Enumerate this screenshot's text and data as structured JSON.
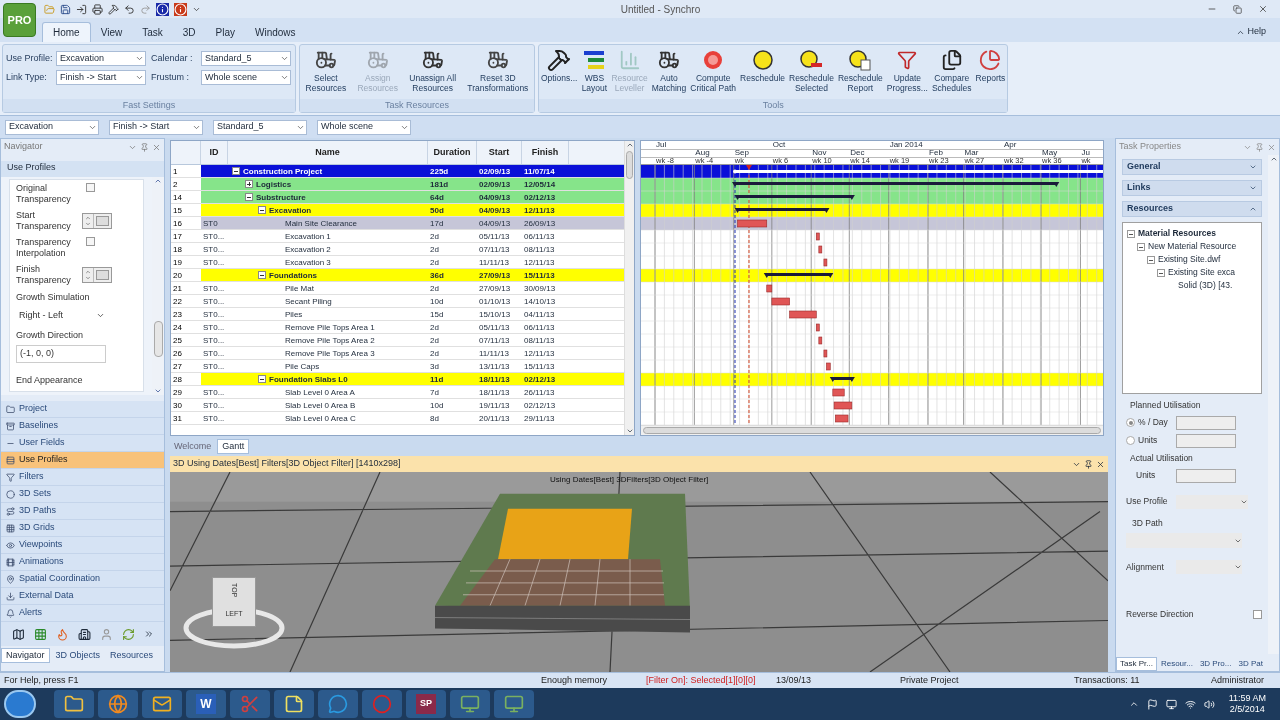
{
  "window": {
    "title": "Untitled - Synchro",
    "app_button": "PRO"
  },
  "ribbon_tabs": [
    {
      "label": "Home",
      "selected": true
    },
    {
      "label": "View",
      "selected": false
    },
    {
      "label": "Task",
      "selected": false
    },
    {
      "label": "3D",
      "selected": false
    },
    {
      "label": "Play",
      "selected": false
    },
    {
      "label": "Windows",
      "selected": false
    }
  ],
  "help": "Help",
  "fast_settings": {
    "label": "Fast Settings",
    "fields": [
      {
        "label": "Use Profile:",
        "value": "Excavation"
      },
      {
        "label": "Calendar :",
        "value": "Standard_5"
      },
      {
        "label": "Link Type:",
        "value": "Finish -> Start"
      },
      {
        "label": "Frustum :",
        "value": "Whole scene"
      }
    ]
  },
  "task_resources": {
    "label": "Task Resources",
    "buttons": [
      {
        "lines": [
          "Select",
          "Resources"
        ],
        "disabled": false
      },
      {
        "lines": [
          "Assign",
          "Resources"
        ],
        "disabled": true
      },
      {
        "lines": [
          "Unassign All",
          "Resources"
        ],
        "disabled": false
      },
      {
        "lines": [
          "Reset 3D",
          "Transformations"
        ],
        "disabled": false
      }
    ]
  },
  "tools": {
    "label": "Tools",
    "buttons": [
      {
        "lines": [
          "Options..."
        ],
        "disabled": false
      },
      {
        "lines": [
          "WBS",
          "Layout"
        ],
        "disabled": false
      },
      {
        "lines": [
          "Resource",
          "Leveller"
        ],
        "disabled": true
      },
      {
        "lines": [
          "Auto",
          "Matching"
        ],
        "disabled": false
      },
      {
        "lines": [
          "Compute",
          "Critical Path"
        ],
        "disabled": false
      },
      {
        "lines": [
          "Reschedule"
        ],
        "disabled": false
      },
      {
        "lines": [
          "Reschedule",
          "Selected"
        ],
        "disabled": false
      },
      {
        "lines": [
          "Reschedule",
          "Report"
        ],
        "disabled": false
      },
      {
        "lines": [
          "Update",
          "Progress..."
        ],
        "disabled": false
      },
      {
        "lines": [
          "Compare",
          "Schedules"
        ],
        "disabled": false
      },
      {
        "lines": [
          "Reports"
        ],
        "disabled": false
      }
    ]
  },
  "toolbar": [
    "Excavation",
    "Finish -> Start",
    "Standard_5",
    "Whole scene"
  ],
  "navigator": {
    "title": "Navigator",
    "section": "Use Profiles",
    "form": [
      {
        "kind": "checkbox",
        "label": "Original Transparency",
        "checked": false
      },
      {
        "kind": "spinner",
        "label": "Start Transparency"
      },
      {
        "kind": "checkbox",
        "label": "Transparency Interpolation",
        "checked": false
      },
      {
        "kind": "spinner",
        "label": "Finish Transparency"
      },
      {
        "kind": "dropdown",
        "label": "Growth Simulation",
        "value": "Right - Left"
      },
      {
        "kind": "field",
        "label": "Growth Direction",
        "value": "(-1, 0, 0)"
      },
      {
        "kind": "heading",
        "label": "End Appearance"
      }
    ],
    "items": [
      {
        "label": "Project",
        "selected": false
      },
      {
        "label": "Baselines",
        "selected": false
      },
      {
        "label": "User Fields",
        "selected": false
      },
      {
        "label": "Use Profiles",
        "selected": true
      },
      {
        "label": "Filters",
        "selected": false
      },
      {
        "label": "3D Sets",
        "selected": false
      },
      {
        "label": "3D Paths",
        "selected": false
      },
      {
        "label": "3D Grids",
        "selected": false
      },
      {
        "label": "Viewpoints",
        "selected": false
      },
      {
        "label": "Animations",
        "selected": false
      },
      {
        "label": "Spatial Coordination",
        "selected": false
      },
      {
        "label": "External Data",
        "selected": false
      },
      {
        "label": "Alerts",
        "selected": false
      }
    ],
    "tabs": [
      {
        "label": "Navigator",
        "selected": true
      },
      {
        "label": "3D Objects",
        "selected": false
      },
      {
        "label": "Resources",
        "selected": false
      }
    ]
  },
  "table": {
    "columns": [
      "ID",
      "Name",
      "Duration",
      "Start",
      "Finish"
    ]
  },
  "tasks": [
    {
      "num": "1",
      "name": "Construction Project",
      "duration": "225d",
      "start": "02/09/13",
      "finish": "11/07/14",
      "expanded": true,
      "children": [
        {
          "num": "2",
          "name": "Logistics",
          "duration": "181d",
          "start": "02/09/13",
          "finish": "12/05/14",
          "expanded": false
        },
        {
          "num": "14",
          "name": "Substructure",
          "duration": "64d",
          "start": "04/09/13",
          "finish": "02/12/13",
          "expanded": true,
          "children": [
            {
              "num": "15",
              "name": "Excavation",
              "duration": "50d",
              "start": "04/09/13",
              "finish": "12/11/13",
              "expanded": true,
              "children": [
                {
                  "num": "16",
                  "id": "ST0",
                  "name": "Main Site Clearance",
                  "duration": "17d",
                  "start": "04/09/13",
                  "finish": "26/09/13",
                  "selected": true
                },
                {
                  "num": "17",
                  "id": "ST0...",
                  "name": "Excavation 1",
                  "duration": "2d",
                  "start": "05/11/13",
                  "finish": "06/11/13",
                  "selected": false
                },
                {
                  "num": "18",
                  "id": "ST0...",
                  "name": "Excavation 2",
                  "duration": "2d",
                  "start": "07/11/13",
                  "finish": "08/11/13",
                  "selected": false
                },
                {
                  "num": "19",
                  "id": "ST0...",
                  "name": "Excavation 3",
                  "duration": "2d",
                  "start": "11/11/13",
                  "finish": "12/11/13",
                  "selected": false
                }
              ]
            },
            {
              "num": "20",
              "name": "Foundations",
              "duration": "36d",
              "start": "27/09/13",
              "finish": "15/11/13",
              "expanded": true,
              "children": [
                {
                  "num": "21",
                  "id": "ST0...",
                  "name": "Pile Mat",
                  "duration": "2d",
                  "start": "27/09/13",
                  "finish": "30/09/13",
                  "selected": false
                },
                {
                  "num": "22",
                  "id": "ST0...",
                  "name": "Secant Piling",
                  "duration": "10d",
                  "start": "01/10/13",
                  "finish": "14/10/13",
                  "selected": false
                },
                {
                  "num": "23",
                  "id": "ST0...",
                  "name": "Piles",
                  "duration": "15d",
                  "start": "15/10/13",
                  "finish": "04/11/13",
                  "selected": false
                },
                {
                  "num": "24",
                  "id": "ST0...",
                  "name": "Remove Pile Tops Area 1",
                  "duration": "2d",
                  "start": "05/11/13",
                  "finish": "06/11/13",
                  "selected": false
                },
                {
                  "num": "25",
                  "id": "ST0...",
                  "name": "Remove Pile Tops Area 2",
                  "duration": "2d",
                  "start": "07/11/13",
                  "finish": "08/11/13",
                  "selected": false
                },
                {
                  "num": "26",
                  "id": "ST0...",
                  "name": "Remove Pile Tops Area 3",
                  "duration": "2d",
                  "start": "11/11/13",
                  "finish": "12/11/13",
                  "selected": false
                },
                {
                  "num": "27",
                  "id": "ST0...",
                  "name": "Pile Caps",
                  "duration": "3d",
                  "start": "13/11/13",
                  "finish": "15/11/13",
                  "selected": false
                }
              ]
            },
            {
              "num": "28",
              "name": "Foundation Slabs L0",
              "duration": "11d",
              "start": "18/11/13",
              "finish": "02/12/13",
              "expanded": true,
              "children": [
                {
                  "num": "29",
                  "id": "ST0...",
                  "name": "Slab Level 0 Area A",
                  "duration": "7d",
                  "start": "18/11/13",
                  "finish": "26/11/13",
                  "selected": false
                },
                {
                  "num": "30",
                  "id": "ST0...",
                  "name": "Slab Level 0 Area B",
                  "duration": "10d",
                  "start": "19/11/13",
                  "finish": "02/12/13",
                  "selected": false
                },
                {
                  "num": "31",
                  "id": "ST0...",
                  "name": "Slab Level 0 Area C",
                  "duration": "8d",
                  "start": "20/11/13",
                  "finish": "29/11/13",
                  "selected": false
                }
              ]
            }
          ]
        }
      ]
    }
  ],
  "timescale": {
    "months": [
      "Jul",
      "Aug",
      "Sep",
      "Oct",
      "Nov",
      "Dec",
      "Jan 2014",
      "Feb",
      "Mar",
      "Apr",
      "May",
      "Ju"
    ],
    "weeks": [
      "wk -8",
      "wk -4",
      "wk",
      "wk 6",
      "wk 10",
      "wk 14",
      "wk 19",
      "wk 23",
      "wk 27",
      "wk 32",
      "wk 36",
      "wk"
    ]
  },
  "view_tabs": [
    {
      "label": "Welcome",
      "selected": false
    },
    {
      "label": "Gantt",
      "selected": true
    }
  ],
  "view3d": {
    "title": "3D Using Dates[Best] Filters[3D Object Filter] [1410x298]",
    "caption": "Using Dates[Best] 3DFilters[3D Object Filter]",
    "cube_top": "TOP",
    "cube_side": "LEFT"
  },
  "task_properties": {
    "title": "Task Properties",
    "sections": [
      {
        "label": "General",
        "expanded": false
      },
      {
        "label": "Links",
        "expanded": false
      },
      {
        "label": "Resources",
        "expanded": true
      }
    ],
    "resources": [
      {
        "label": "Material Resources",
        "expanded": true,
        "children": [
          {
            "label": "New Material Resource",
            "expanded": true,
            "children": [
              {
                "label": "Existing Site.dwf",
                "expanded": true,
                "children": [
                  {
                    "label": "Existing Site exca",
                    "expanded": true,
                    "children": [
                      {
                        "label": "Solid (3D) [43."
                      }
                    ]
                  }
                ]
              }
            ]
          }
        ]
      }
    ],
    "planned_utilisation": {
      "label": "Planned Utilisation",
      "options": [
        {
          "label": "% / Day",
          "selected": true
        },
        {
          "label": "Units",
          "selected": false
        }
      ]
    },
    "actual_utilisation": {
      "label": "Actual Utilisation",
      "field_label": "Units"
    },
    "use_profile": "Use Profile",
    "path_3d": "3D Path",
    "alignment": "Alignment",
    "reverse_direction": {
      "label": "Reverse Direction",
      "checked": false
    },
    "tabs": [
      {
        "label": "Task Pr...",
        "selected": true
      },
      {
        "label": "Resour...",
        "selected": false
      },
      {
        "label": "3D Pro...",
        "selected": false
      },
      {
        "label": "3D Pat",
        "selected": false
      }
    ]
  },
  "status_bar": [
    {
      "kind": "help",
      "text": "For Help, press F1"
    },
    {
      "kind": "memory",
      "text": "Enough memory"
    },
    {
      "kind": "filter",
      "text": "[Filter On]: Selected[1][0][0]"
    },
    {
      "kind": "date",
      "text": "13/09/13"
    },
    {
      "kind": "project",
      "text": "Private Project"
    },
    {
      "kind": "transactions",
      "text": "Transactions: 11"
    },
    {
      "kind": "user",
      "text": "Administrator"
    }
  ],
  "taskbar": {
    "apps": [
      {
        "kind": "folder"
      },
      {
        "kind": "browser"
      },
      {
        "kind": "mail"
      },
      {
        "kind": "document",
        "label": "W"
      },
      {
        "kind": "scissors"
      },
      {
        "kind": "note"
      },
      {
        "kind": "chat"
      },
      {
        "kind": "ring"
      },
      {
        "kind": "tile",
        "label": "SP"
      },
      {
        "kind": "app"
      },
      {
        "kind": "app"
      }
    ],
    "time": "11:59 AM",
    "date": "2/5/2014"
  }
}
